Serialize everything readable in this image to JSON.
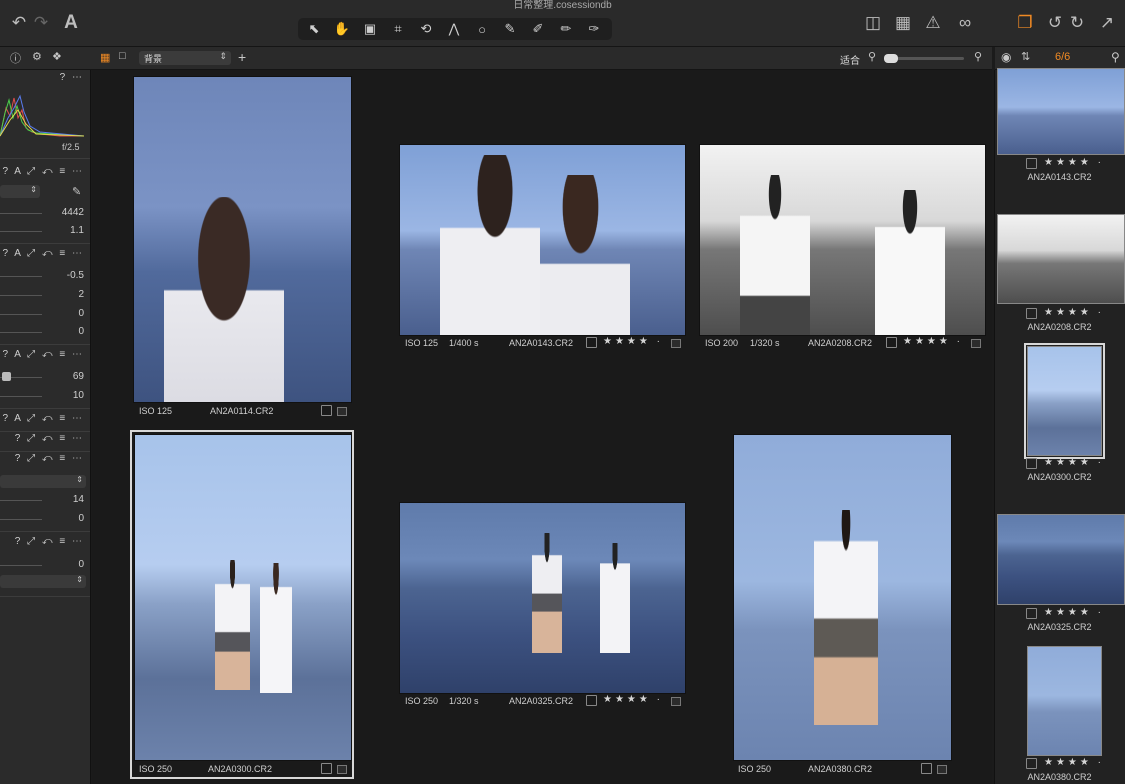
{
  "window": {
    "title": "日常整理.cosessiondb"
  },
  "toolbar": {
    "text_icon": "A",
    "tools": [
      "select-tool",
      "pan-tool",
      "loupe-tool",
      "crop-tool",
      "rotate-tool",
      "keystone-tool",
      "spot-tool",
      "picker-tool",
      "brush-tool",
      "eraser-tool"
    ]
  },
  "browser_bar": {
    "collection": "背景",
    "fit_label": "适合",
    "count": "6/6"
  },
  "left_panel": {
    "histogram_aperture": "f/2.5",
    "values": [
      "4442",
      "1.1",
      "-0.5",
      "2",
      "0",
      "0",
      "69",
      "10",
      "14",
      "0",
      "0"
    ]
  },
  "photos": [
    {
      "iso": "ISO 125",
      "shutter": "",
      "file": "AN2A0114.CR2",
      "rating": ""
    },
    {
      "iso": "ISO 125",
      "shutter": "1/400 s",
      "file": "AN2A0143.CR2",
      "rating": "★★★★ ·"
    },
    {
      "iso": "ISO 200",
      "shutter": "1/320 s",
      "file": "AN2A0208.CR2",
      "rating": "★★★★ ·"
    },
    {
      "iso": "ISO 250",
      "shutter": "",
      "file": "AN2A0300.CR2",
      "rating": ""
    },
    {
      "iso": "ISO 250",
      "shutter": "1/320 s",
      "file": "AN2A0325.CR2",
      "rating": "★★★★ ·"
    },
    {
      "iso": "ISO 250",
      "shutter": "",
      "file": "AN2A0380.CR2",
      "rating": ""
    }
  ],
  "filmstrip": [
    {
      "file": "AN2A0143.CR2",
      "rating": "★★★★ ·"
    },
    {
      "file": "AN2A0208.CR2",
      "rating": "★★★★ ·"
    },
    {
      "file": "AN2A0300.CR2",
      "rating": "★★★★ ·"
    },
    {
      "file": "AN2A0325.CR2",
      "rating": "★★★★ ·"
    },
    {
      "file": "AN2A0380.CR2",
      "rating": "★★★★ ·"
    }
  ],
  "colors": {
    "accent": "#f08a24",
    "panel": "#2b2b2b",
    "background": "#1a1a1a"
  }
}
